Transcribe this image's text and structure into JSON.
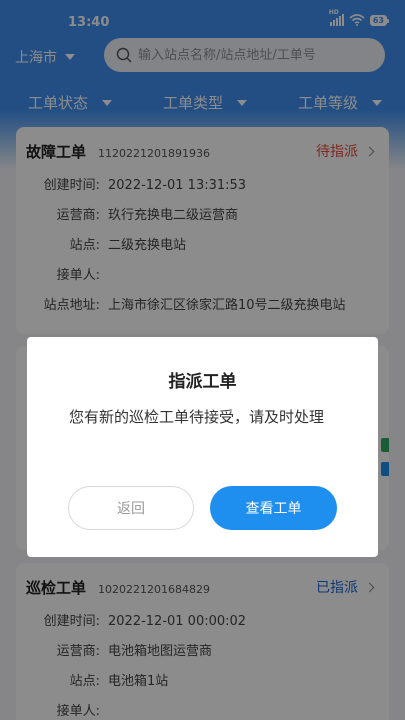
{
  "status_bar": {
    "time": "13:40",
    "signal_label": "HD",
    "battery": "63"
  },
  "header": {
    "city": "上海市",
    "search_placeholder": "输入站点名称/站点地址/工单号"
  },
  "filters": [
    "工单状态",
    "工单类型",
    "工单等级"
  ],
  "cards": [
    {
      "type": "故障工单",
      "order_no": "1120221201891936",
      "status": "待指派",
      "status_color": "#e84a3d",
      "rows": [
        {
          "label": "创建时间:",
          "value": "2022-12-01 13:31:53"
        },
        {
          "label": "运营商:",
          "value": "玖行充换电二级运营商"
        },
        {
          "label": "站点:",
          "value": "二级充换电站"
        },
        {
          "label": "接单人:",
          "value": ""
        },
        {
          "label": "站点地址:",
          "value": "上海市徐汇区徐家汇路10号二级充换电站"
        }
      ]
    },
    {
      "type": "巡检工单",
      "order_no": "1020221201684829",
      "status": "已指派",
      "status_color": "#1e64d6",
      "rows": [
        {
          "label": "创建时间:",
          "value": "2022-12-01 00:00:02"
        },
        {
          "label": "运营商:",
          "value": "电池箱地图运营商"
        },
        {
          "label": "站点:",
          "value": "电池箱1站"
        },
        {
          "label": "接单人:",
          "value": ""
        }
      ]
    }
  ],
  "dialog": {
    "title": "指派工单",
    "message": "您有新的巡检工单待接受，请及时处理",
    "back_label": "返回",
    "view_label": "查看工单"
  },
  "colors": {
    "primary": "#3f8ff0",
    "button": "#1e8fee"
  }
}
